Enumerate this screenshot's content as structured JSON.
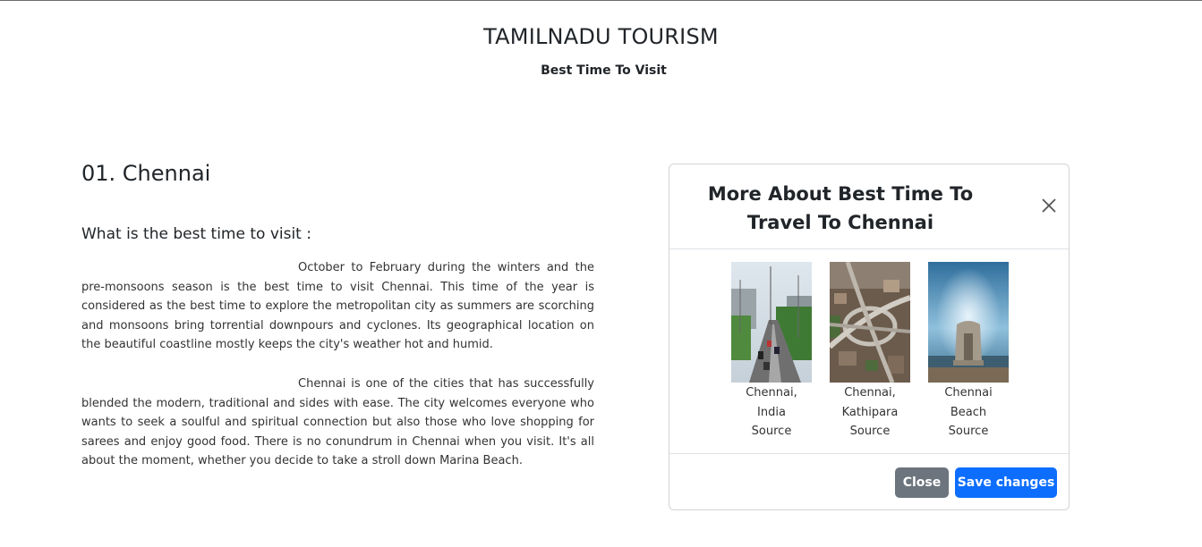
{
  "header": {
    "title": "TAMILNADU TOURISM",
    "subtitle": "Best Time To Visit"
  },
  "content": {
    "city_heading": "01. Chennai",
    "question": "What is the best time to visit :",
    "paragraphs": [
      "October to February during the winters and the pre-monsoons season is the best time to visit Chennai. This time of the year is considered as the best time to explore the metropolitan city as summers are scorching and monsoons bring torrential downpours and cyclones. Its geographical location on the beautiful coastline mostly keeps the city's weather hot and humid.",
      "Chennai is one of the cities that has successfully blended the modern, traditional and sides with ease. The city welcomes everyone who wants to seek a soulful and spiritual connection but also those who love shopping for sarees and enjoy good food. There is no conundrum in Chennai when you visit. It's all about the moment, whether you decide to take a stroll down Marina Beach."
    ]
  },
  "modal": {
    "title": "More About Best Time To Travel To Chennai",
    "close_icon": "close-icon",
    "photos": [
      {
        "line1": "Chennai,",
        "line2": "India",
        "line3": "Source"
      },
      {
        "line1": "Chennai,",
        "line2": "Kathipara",
        "line3": "Source"
      },
      {
        "line1": "Chennai",
        "line2": "Beach",
        "line3": "Source"
      }
    ],
    "close_button": "Close",
    "save_button": "Save changes"
  },
  "colors": {
    "primary": "#0d6efd",
    "secondary": "#6c757d",
    "text": "#212529"
  }
}
